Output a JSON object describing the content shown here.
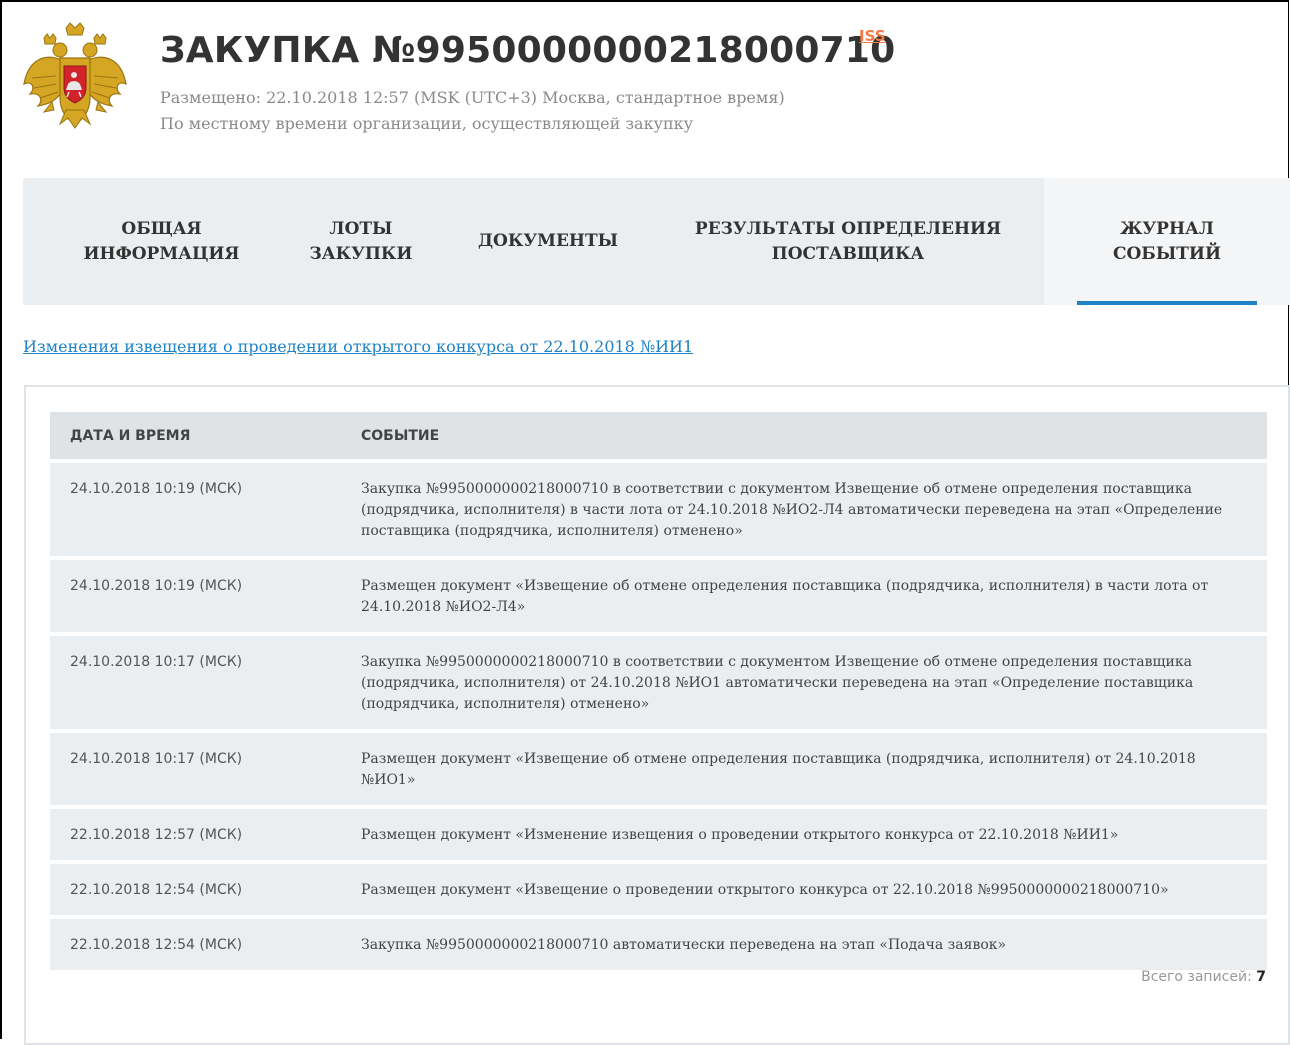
{
  "header": {
    "title": "ЗАКУПКА №9950000000218000710",
    "iss_label": "ISS",
    "posted": "Размещено: 22.10.2018 12:57 (MSK (UTC+3) Москва, стандартное время)",
    "local_time_note": "По местному времени организации, осуществляющей закупку"
  },
  "tabs": [
    {
      "line1": "ОБЩАЯ",
      "line2": "ИНФОРМАЦИЯ",
      "active": false
    },
    {
      "line1": "ЛОТЫ",
      "line2": "ЗАКУПКИ",
      "active": false
    },
    {
      "line1": "ДОКУМЕНТЫ",
      "line2": "",
      "active": false
    },
    {
      "line1": "РЕЗУЛЬТАТЫ ОПРЕДЕЛЕНИЯ",
      "line2": "ПОСТАВЩИКА",
      "active": false
    },
    {
      "line1": "ЖУРНАЛ",
      "line2": "СОБЫТИЙ",
      "active": true
    }
  ],
  "notice_link": "Изменения извещения о проведении открытого конкурса от 22.10.2018 №ИИ1",
  "table": {
    "headers": {
      "date": "ДАТА И ВРЕМЯ",
      "event": "СОБЫТИЕ"
    },
    "rows": [
      {
        "date": "24.10.2018 10:19 (МСК)",
        "event": "Закупка №9950000000218000710 в соответствии с документом Извещение об отмене определения поставщика (подрядчика, исполнителя) в части лота от 24.10.2018 №ИО2-Л4 автоматически переведена на этап «Определение поставщика (подрядчика, исполнителя) отменено»"
      },
      {
        "date": "24.10.2018 10:19 (МСК)",
        "event": "Размещен документ «Извещение об отмене определения поставщика (подрядчика, исполнителя) в части лота от 24.10.2018 №ИО2-Л4»"
      },
      {
        "date": "24.10.2018 10:17 (МСК)",
        "event": "Закупка №9950000000218000710 в соответствии с документом Извещение об отмене определения поставщика (подрядчика, исполнителя) от 24.10.2018 №ИО1 автоматически переведена на этап «Определение поставщика (подрядчика, исполнителя) отменено»"
      },
      {
        "date": "24.10.2018 10:17 (МСК)",
        "event": "Размещен документ «Извещение об отмене определения поставщика (подрядчика, исполнителя) от 24.10.2018 №ИО1»"
      },
      {
        "date": "22.10.2018 12:57 (МСК)",
        "event": "Размещен документ «Изменение извещения о проведении открытого конкурса от 22.10.2018 №ИИ1»"
      },
      {
        "date": "22.10.2018 12:54 (МСК)",
        "event": "Размещен документ «Извещение о проведении открытого конкурса от 22.10.2018 №9950000000218000710»"
      },
      {
        "date": "22.10.2018 12:54 (МСК)",
        "event": "Закупка №9950000000218000710 автоматически переведена на этап «Подача заявок»"
      }
    ]
  },
  "footer": {
    "total_label": "Всего записей:",
    "total_value": "7"
  },
  "icons": {
    "emblem": "russian-coat-of-arms-icon"
  },
  "colors": {
    "accent": "#1f82c6",
    "iss": "#f47a44",
    "tab_bg": "#ebeef0",
    "header_bg": "#dfe3e6"
  }
}
